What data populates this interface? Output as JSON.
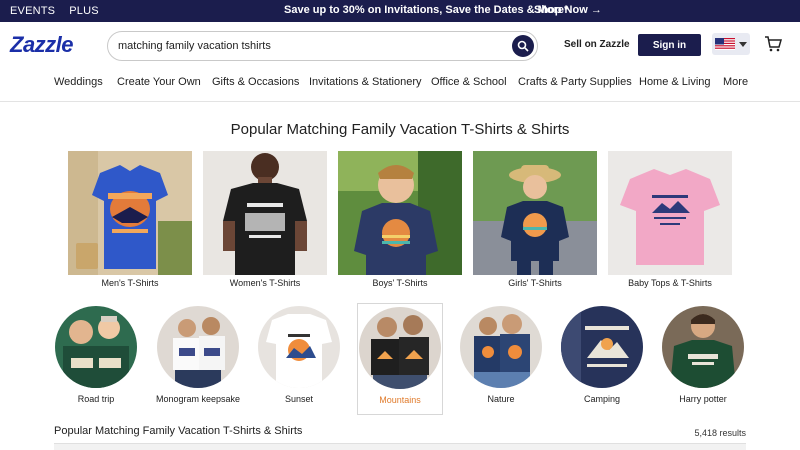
{
  "topbar": {
    "links": [
      "EVENTS",
      "PLUS"
    ],
    "promo": "Save up to 30% on Invitations, Save the Dates & More*",
    "shop_now": "Shop Now →"
  },
  "header": {
    "logo": "Zazzle",
    "search_value": "matching family vacation tshirts",
    "sell": "Sell on Zazzle",
    "signin": "Sign in",
    "search_icon": "search-icon",
    "flag_icon": "us-flag-icon",
    "cart_icon": "cart-icon"
  },
  "nav": {
    "items": [
      "Weddings",
      "Create Your Own",
      "Gifts & Occasions",
      "Invitations & Stationery",
      "Office & School",
      "Crafts & Party Supplies",
      "Home & Living",
      "More"
    ]
  },
  "title": "Popular Matching Family Vacation T-Shirts & Shirts",
  "tiles": [
    {
      "label": "Men's T-Shirts"
    },
    {
      "label": "Women's T-Shirts"
    },
    {
      "label": "Boys' T-Shirts"
    },
    {
      "label": "Girls' T-Shirts"
    },
    {
      "label": "Baby Tops & T-Shirts"
    }
  ],
  "circles": [
    {
      "label": "Road trip"
    },
    {
      "label": "Monogram keepsake"
    },
    {
      "label": "Sunset"
    },
    {
      "label": "Mountains",
      "selected": true
    },
    {
      "label": "Nature"
    },
    {
      "label": "Camping"
    },
    {
      "label": "Harry potter"
    }
  ],
  "subtitle": "Popular Matching Family Vacation T-Shirts & Shirts",
  "results": "5,418 results",
  "colors": {
    "brand_navy": "#1b1d4d",
    "logo_blue": "#1b2fa8",
    "selected_orange": "#e07b2c"
  }
}
